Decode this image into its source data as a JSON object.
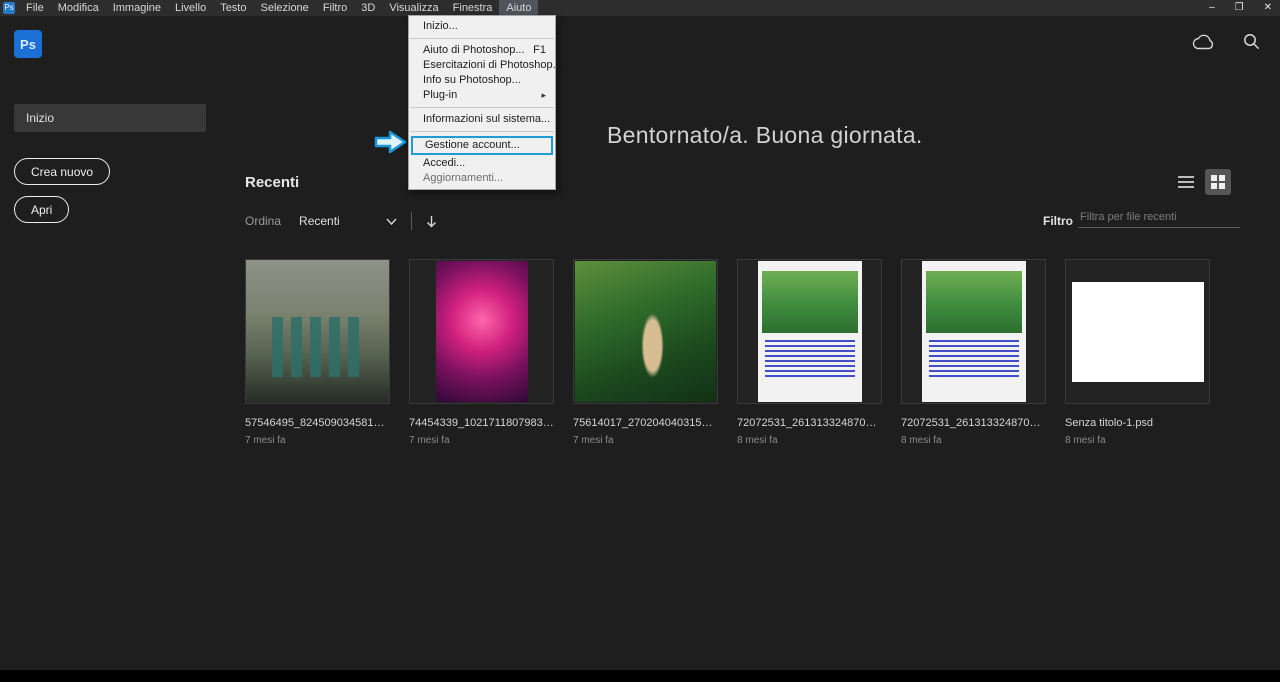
{
  "app": {
    "badge": "Ps"
  },
  "menubar": {
    "items": [
      "File",
      "Modifica",
      "Immagine",
      "Livello",
      "Testo",
      "Selezione",
      "Filtro",
      "3D",
      "Visualizza",
      "Finestra",
      "Aiuto"
    ],
    "active_item": "Aiuto"
  },
  "window_controls": {
    "minimize": "–",
    "restore": "❐",
    "close": "✕"
  },
  "help_menu": {
    "items": [
      {
        "label": "Inizio..."
      },
      {
        "label": "Aiuto di Photoshop...",
        "shortcut": "F1"
      },
      {
        "label": "Esercitazioni di Photoshop..."
      },
      {
        "label": "Info su Photoshop..."
      },
      {
        "label": "Plug-in"
      },
      {
        "label": "Informazioni sul sistema..."
      },
      {
        "label": "Gestione account..."
      },
      {
        "label": "Accedi..."
      },
      {
        "label": "Aggiornamenti..."
      }
    ],
    "highlighted_item": "Gestione account...",
    "highlight_color": "#1f9cd8"
  },
  "sidebar": {
    "home": "Inizio",
    "create_label": "Crea nuovo",
    "open_label": "Apri"
  },
  "main": {
    "welcome": "Bentornato/a. Buona giornata.",
    "section_title": "Recenti",
    "sort_label": "Ordina",
    "sort_value": "Recenti",
    "filter_label": "Filtro",
    "filter_placeholder": "Filtra per file recenti",
    "files": [
      {
        "name": "57546495_824509034581921...",
        "age": "7 mesi fa"
      },
      {
        "name": "74454339_10217118079839112...",
        "age": "7 mesi fa"
      },
      {
        "name": "75614017_2702040403150307...",
        "age": "7 mesi fa"
      },
      {
        "name": "72072531_2613133248707690...",
        "age": "8 mesi fa"
      },
      {
        "name": "72072531_2613133248707690...",
        "age": "8 mesi fa"
      },
      {
        "name": "Senza titolo-1.psd",
        "age": "8 mesi fa"
      }
    ]
  }
}
